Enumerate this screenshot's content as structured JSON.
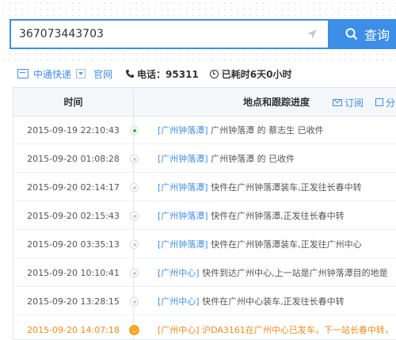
{
  "search": {
    "value": "367073443703",
    "button_label": "查询"
  },
  "company": {
    "name": "中通快递",
    "official_site": "官网",
    "phone_label": "电话：95311",
    "elapsed_label": "已耗时6天0小时"
  },
  "table": {
    "headers": {
      "time": "时间",
      "place": "地点和跟踪进度",
      "subscribe": "订阅",
      "share": "分"
    },
    "rows": [
      {
        "time": "2015-09-19 22:10:43",
        "location": "[广州钟落潭]",
        "text": " 广州钟落潭 的 蔡志生 已收件"
      },
      {
        "time": "2015-09-20 01:08:28",
        "location": "[广州钟落潭]",
        "text": " 广州钟落潭 的 已收件"
      },
      {
        "time": "2015-09-20 02:14:17",
        "location": "[广州钟落潭]",
        "text": " 快件在广州钟落潭装车,正发往长春中转"
      },
      {
        "time": "2015-09-20 02:15:43",
        "location": "[广州钟落潭]",
        "text": " 快件在广州钟落潭,正发往长春中转"
      },
      {
        "time": "2015-09-20 03:35:13",
        "location": "[广州钟落潭]",
        "text": " 快件在广州钟落潭装车,正发往广州中心"
      },
      {
        "time": "2015-09-20 10:10:41",
        "location": "[广州中心]",
        "text": " 快件到达广州中心,上一站是广州钟落潭目的地是"
      },
      {
        "time": "2015-09-20 13:28:15",
        "location": "[广州中心]",
        "text": " 快件在广州中心装车,正发往长春中转"
      },
      {
        "time": "2015-09-20 14:07:18",
        "location": "[广州中心]",
        "text": " 沪DA3161在广州中心已发车，下一站长春中转，"
      }
    ]
  }
}
